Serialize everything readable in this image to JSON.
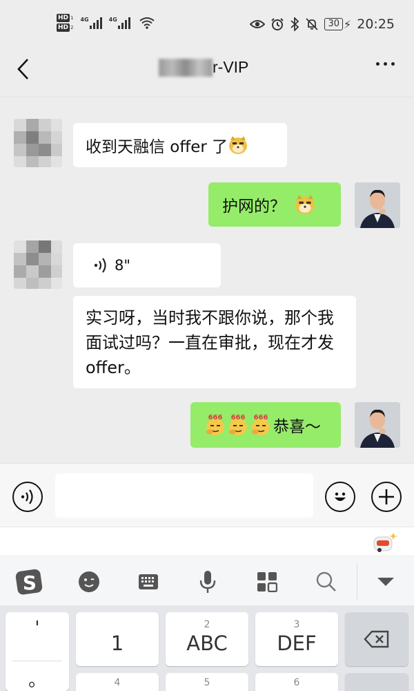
{
  "status_bar": {
    "hd1": "HD",
    "hd1_sub": "1",
    "hd2": "HD",
    "hd2_sub": "2",
    "net1": "4G",
    "net2": "4G",
    "battery": "30",
    "time": "20:25",
    "icons": [
      "eye-icon",
      "alarm-icon",
      "bluetooth-icon",
      "mute-bell-icon",
      "battery-icon",
      "charging-icon"
    ]
  },
  "nav": {
    "title_visible": "r-VIP",
    "back_icon": "chevron-left-icon",
    "more_icon": "more-dots-icon"
  },
  "messages": [
    {
      "side": "left",
      "text": "收到天融信 offer 了",
      "emoji": "doge-emoji"
    },
    {
      "side": "right",
      "text": "护网的？",
      "emoji": "doge-emoji"
    },
    {
      "side": "left",
      "type": "voice",
      "duration": "8\""
    },
    {
      "side": "left",
      "text": "实习呀，当时我不跟你说，那个我面试过吗？一直在审批，现在才发 offer。"
    },
    {
      "side": "right",
      "text": "恭喜～",
      "emoji_prefix": "666-emoji x3",
      "emoji_label": "666"
    }
  ],
  "input_bar": {
    "voice_icon": "voice-icon",
    "text_value": "",
    "emoji_icon": "smiley-icon",
    "plus_icon": "plus-icon"
  },
  "keyboard": {
    "toolbar_icons": [
      "sogou-logo-icon",
      "emoji-face-icon",
      "keyboard-icon",
      "microphone-icon",
      "apps-grid-icon",
      "search-icon",
      "collapse-triangle-icon"
    ],
    "punct_keys": [
      "'",
      "。"
    ],
    "keys": [
      {
        "num": "",
        "label": "1"
      },
      {
        "num": "2",
        "label": "ABC"
      },
      {
        "num": "3",
        "label": "DEF"
      }
    ],
    "second_row_nums": [
      "4",
      "5",
      "6"
    ],
    "delete_icon": "backspace-icon"
  }
}
